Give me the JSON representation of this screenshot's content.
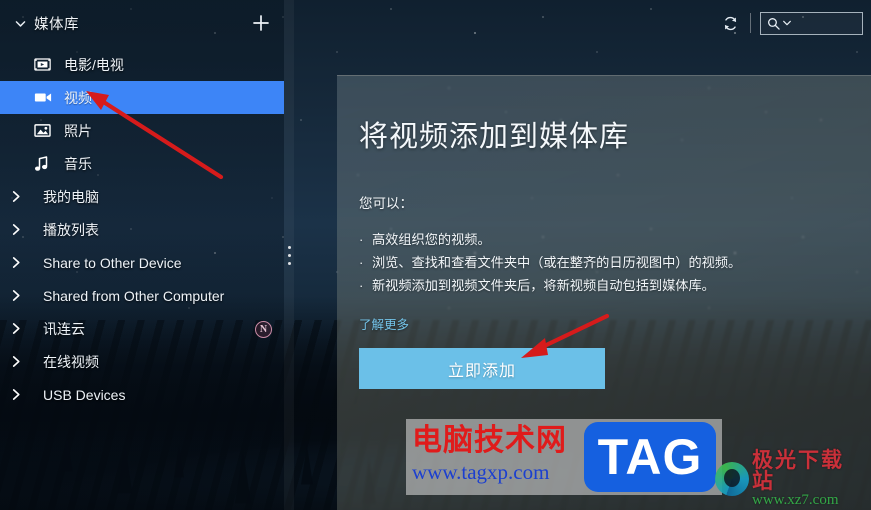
{
  "window": {
    "app_title": "媒体库"
  },
  "sidebar": {
    "header": {
      "title": "媒体库",
      "collapse_icon": "chevron-down-icon",
      "add_icon": "plus-icon"
    },
    "items": [
      {
        "label": "电影/电视",
        "icon": "film-icon",
        "level": "child",
        "selected": false
      },
      {
        "label": "视频",
        "icon": "video-camera-icon",
        "level": "child",
        "selected": true
      },
      {
        "label": "照片",
        "icon": "photo-icon",
        "level": "child",
        "selected": false
      },
      {
        "label": "音乐",
        "icon": "music-note-icon",
        "level": "child",
        "selected": false
      },
      {
        "label": "我的电脑",
        "icon": "chevron-right-icon",
        "level": "top",
        "selected": false
      },
      {
        "label": "播放列表",
        "icon": "chevron-right-icon",
        "level": "top",
        "selected": false
      },
      {
        "label": "Share to Other Device",
        "icon": "chevron-right-icon",
        "level": "top",
        "selected": false
      },
      {
        "label": "Shared from Other Computer",
        "icon": "chevron-right-icon",
        "level": "top",
        "selected": false
      },
      {
        "label": "讯连云",
        "icon": "chevron-right-icon",
        "level": "top",
        "selected": false
      },
      {
        "label": "在线视频",
        "icon": "chevron-right-icon",
        "level": "top",
        "selected": false
      },
      {
        "label": "USB Devices",
        "icon": "chevron-right-icon",
        "level": "top",
        "selected": false
      }
    ],
    "new_badge": "N",
    "selected_color": "#3d85f7"
  },
  "toolbar": {
    "refresh_icon": "refresh-icon",
    "search": {
      "icon": "search-icon",
      "caret_icon": "chevron-down-icon",
      "value": "",
      "placeholder": ""
    }
  },
  "main": {
    "title": "将视频添加到媒体库",
    "subtitle": "您可以：",
    "bullet_marker": "·",
    "bullets": [
      "高效组织您的视频。",
      "浏览、查找和查看文件夹中（或在整齐的日历视图中）的视频。",
      "新视频添加到视频文件夹后，将新视频自动包括到媒体库。"
    ],
    "learn_more": "了解更多",
    "learn_more_color": "#74c4ea",
    "add_now_button": "立即添加",
    "add_now_color": "#6bc0e8"
  },
  "annotations": {
    "arrow_color": "#d61b1b",
    "arrows": [
      {
        "name": "arrow-to-video-item",
        "points": "from (220,176) to (88,92)"
      },
      {
        "name": "arrow-to-add-button",
        "points": "from (605,317) to (523,357)"
      }
    ]
  },
  "watermarks": {
    "tagxp": {
      "cn": "电脑技术网",
      "url": "www.tagxp.com",
      "logo": "TAG"
    },
    "jiguang": {
      "cn": "极光下载站",
      "url": "www.xz7.com"
    }
  }
}
